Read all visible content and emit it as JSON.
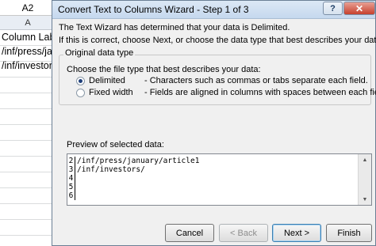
{
  "sheet": {
    "name_box": "A2",
    "column_header": "A",
    "cells": [
      "Column Label",
      "/inf/press/janu",
      "/inf/investors"
    ]
  },
  "dialog": {
    "title": "Convert Text to Columns Wizard - Step 1 of 3",
    "help_glyph": "?",
    "close_glyph": "✕",
    "intro_line1": "The Text Wizard has determined that your data is Delimited.",
    "intro_line2": "If this is correct, choose Next, or choose the data type that best describes your data.",
    "original_data_type": {
      "legend": "Original data type",
      "prompt": "Choose the file type that best describes your data:",
      "options": [
        {
          "label": "Delimited",
          "description": "- Characters such as commas or tabs separate each field.",
          "selected": true
        },
        {
          "label": "Fixed width",
          "description": "- Fields are aligned in columns with spaces between each field.",
          "selected": false
        }
      ]
    },
    "preview": {
      "label": "Preview of selected data:",
      "rows": [
        {
          "num": "2",
          "text": "/inf/press/january/article1"
        },
        {
          "num": "3",
          "text": "/inf/investors/"
        },
        {
          "num": "4",
          "text": ""
        },
        {
          "num": "5",
          "text": ""
        },
        {
          "num": "6",
          "text": ""
        }
      ]
    },
    "buttons": {
      "cancel": "Cancel",
      "back": "< Back",
      "next": "Next >",
      "finish": "Finish"
    }
  },
  "colors": {
    "title_bar": "#c5d8ee",
    "close_button": "#c7402d",
    "dialog_bg": "#f0f0f0"
  }
}
